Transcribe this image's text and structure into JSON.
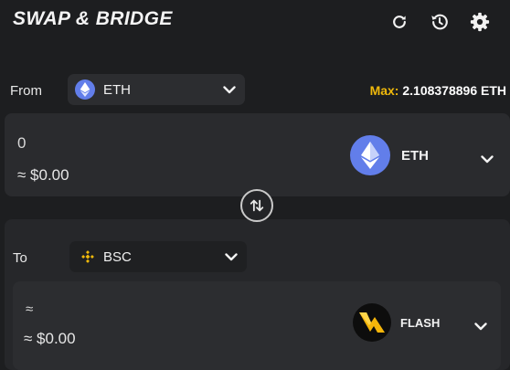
{
  "header": {
    "title": "SWAP & BRIDGE",
    "icons": [
      "refresh-icon",
      "history-icon",
      "gear-icon"
    ]
  },
  "from": {
    "label": "From",
    "network": "ETH",
    "max_label": "Max:",
    "max_value": "2.108378896 ETH",
    "amount": "0",
    "usd": "≈ $0.00",
    "token": "ETH"
  },
  "to": {
    "label": "To",
    "network": "BSC",
    "amount": "≈",
    "usd": "≈ $0.00",
    "token": "FLASH"
  },
  "colors": {
    "accent_max": "#f0b90b",
    "eth_blue": "#627eea",
    "bsc_yellow": "#f0b90b",
    "background": "#1d1e20",
    "card": "#2a2b2e"
  }
}
